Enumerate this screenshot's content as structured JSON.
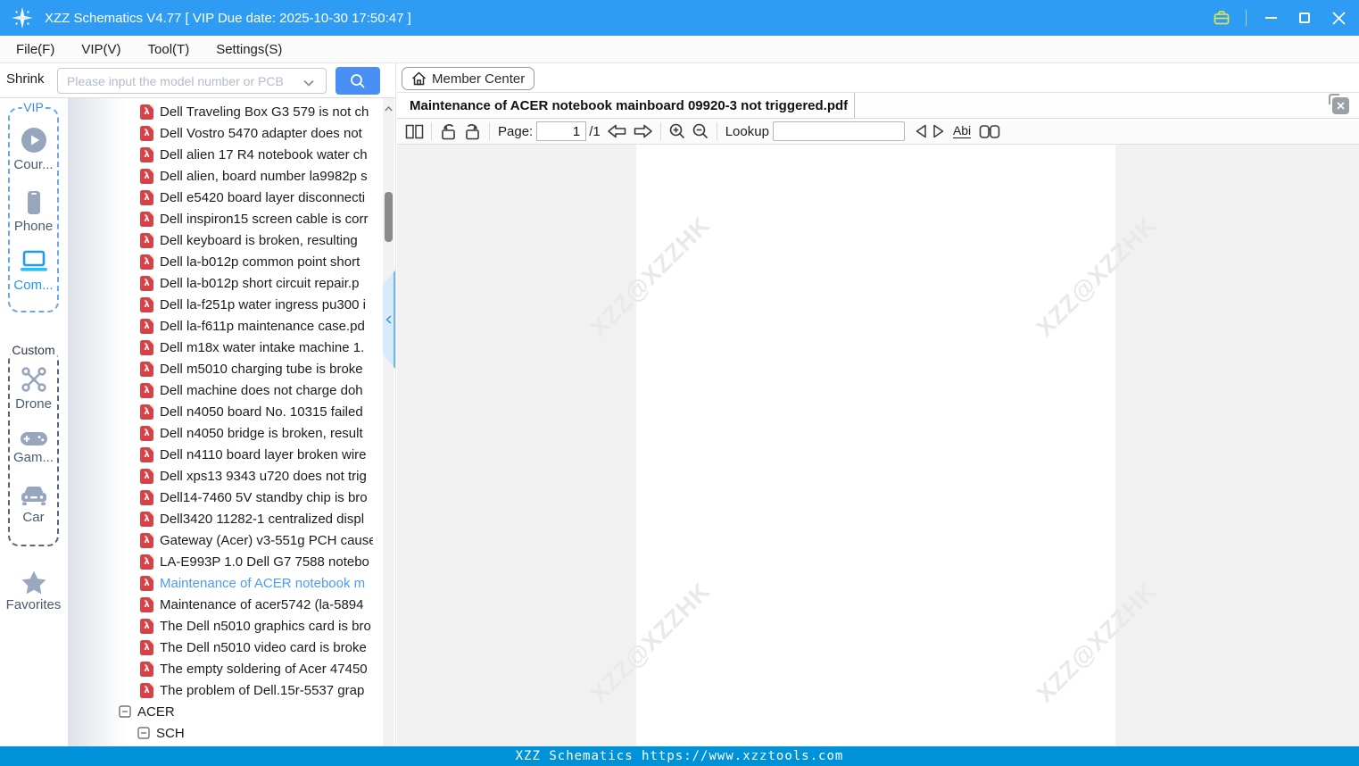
{
  "titlebar": {
    "title": "XZZ Schematics V4.77 [ VIP Due date: 2025-10-30 17:50:47 ]"
  },
  "menubar": {
    "items": [
      "File(F)",
      "VIP(V)",
      "Tool(T)",
      "Settings(S)"
    ]
  },
  "left_header": {
    "shrink_label": "Shrink",
    "search_placeholder": "Please input the model number or PCB"
  },
  "sidebar": {
    "vip_group": {
      "label": "VIP",
      "items": [
        {
          "label": "Cour...",
          "icon": "play-circle-icon"
        },
        {
          "label": "Phone",
          "icon": "phone-icon"
        },
        {
          "label": "Com...",
          "icon": "laptop-icon",
          "active": true
        }
      ]
    },
    "custom_group": {
      "label": "Custom",
      "items": [
        {
          "label": "Drone",
          "icon": "drone-icon"
        },
        {
          "label": "Gam...",
          "icon": "gamepad-icon"
        },
        {
          "label": "Car",
          "icon": "car-icon"
        }
      ]
    },
    "favorites": {
      "label": "Favorites",
      "icon": "star-icon"
    }
  },
  "tree": {
    "files": [
      {
        "label": "Dell Traveling Box G3 579 is not ch"
      },
      {
        "label": "Dell Vostro 5470 adapter does not"
      },
      {
        "label": "Dell alien 17 R4 notebook water ch"
      },
      {
        "label": "Dell alien, board number la9982p s"
      },
      {
        "label": "Dell e5420 board layer disconnecti"
      },
      {
        "label": "Dell inspiron15 screen cable is corr"
      },
      {
        "label": "Dell keyboard is broken, resulting"
      },
      {
        "label": "Dell la-b012p common point short"
      },
      {
        "label": "Dell la-b012p short circuit repair.p"
      },
      {
        "label": "Dell la-f251p water ingress pu300 i"
      },
      {
        "label": "Dell la-f611p maintenance case.pd"
      },
      {
        "label": "Dell m18x water intake machine 1."
      },
      {
        "label": "Dell m5010 charging tube is broke"
      },
      {
        "label": "Dell machine does not charge doh"
      },
      {
        "label": "Dell n4050 board No. 10315 failed"
      },
      {
        "label": "Dell n4050 bridge is broken, result"
      },
      {
        "label": "Dell n4110 board layer broken wire"
      },
      {
        "label": "Dell xps13 9343 u720 does not trig"
      },
      {
        "label": "Dell14-7460 5V standby chip is bro"
      },
      {
        "label": "Dell3420 11282-1 centralized displ"
      },
      {
        "label": "Gateway (Acer) v3-551g PCH cause"
      },
      {
        "label": "LA-E993P 1.0 Dell G7 7588 notebo"
      },
      {
        "label": "Maintenance of ACER notebook m",
        "selected": true
      },
      {
        "label": "Maintenance of acer5742 (la-5894"
      },
      {
        "label": "The Dell n5010 graphics card is bro"
      },
      {
        "label": "The Dell n5010 video card is broke"
      },
      {
        "label": "The empty soldering of Acer 47450"
      },
      {
        "label": "The problem of Dell.15r-5537 grap"
      }
    ],
    "nodes": [
      {
        "label": "ACER",
        "level": 0,
        "state": "expanded"
      },
      {
        "label": "SCH",
        "level": 1,
        "state": "expanded"
      }
    ]
  },
  "member_center": {
    "label": "Member Center",
    "icon": "home-icon"
  },
  "pdf": {
    "tab_title": "Maintenance of ACER notebook mainboard 09920-3 not triggered.pdf",
    "toolbar": {
      "icons": [
        "two-page-view",
        "rotate-left",
        "rotate-right",
        "page-back",
        "page-forward",
        "zoom-in",
        "zoom-out",
        "find-previous",
        "find-next",
        "match-case",
        "highlight-all"
      ],
      "page_label": "Page:",
      "page_value": "1",
      "page_total": "/1",
      "lookup_label": "Lookup",
      "lookup_value": "",
      "abi_label": "Abi"
    },
    "watermark": "XZZ@XZZHK"
  },
  "statusbar": {
    "text": "XZZ Schematics https://www.xzztools.com"
  },
  "colors": {
    "titlebar_blue": "#2e9cf2",
    "statusbar_blue": "#0092d8",
    "accent_blue": "#4a8ff5",
    "selected_text": "#4b9bf5",
    "pdf_icon_red": "#d84247",
    "briefcase_yellow": "#d9e44f"
  }
}
